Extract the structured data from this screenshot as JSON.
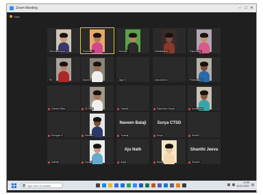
{
  "window": {
    "title": "Zoom Meeting",
    "controls": [
      "–",
      "□",
      "✕"
    ]
  },
  "meeting_bar": {
    "label": "View"
  },
  "participants": [
    {
      "name": "Sarvesh Kumar",
      "row": 0,
      "col": 0,
      "type": "video",
      "skin": "#c99a7a",
      "shirt": "#3a3a6a",
      "bg": "#cfc6b8"
    },
    {
      "name": "Sharmila...",
      "row": 0,
      "col": 1,
      "type": "video",
      "skin": "#b57a60",
      "shirt": "#d04a8a",
      "bg": "#e7a86a",
      "active": true
    },
    {
      "name": "Krishna...",
      "row": 0,
      "col": 2,
      "type": "video",
      "skin": "#b38364",
      "shirt": "#2a2a2a",
      "bg": "#5aa24a"
    },
    {
      "name": "Mahalakshmi",
      "row": 0,
      "col": 3,
      "type": "video",
      "skin": "#7a4a3a",
      "shirt": "#8a3a2a",
      "bg": "#3a2a2a"
    },
    {
      "name": "Rajeshwari",
      "row": 0,
      "col": 4,
      "type": "video",
      "skin": "#c48f74",
      "shirt": "#d85a8a",
      "bg": "#b0a8b4"
    },
    {
      "name": "RK",
      "row": 1,
      "col": 0,
      "type": "video",
      "skin": "#b88468",
      "shirt": "#aa2a2a",
      "bg": "#a8a29a"
    },
    {
      "name": "Naveen",
      "row": 1,
      "col": 1,
      "type": "video",
      "skin": "#9a6a50",
      "shirt": "#eeeeee",
      "bg": "#8a8478"
    },
    {
      "name": "Jaya S",
      "row": 1,
      "col": 2,
      "type": "blank"
    },
    {
      "name": "www.tamil.in",
      "row": 1,
      "col": 3,
      "type": "blank"
    },
    {
      "name": "Prabhakaran",
      "row": 1,
      "col": 4,
      "type": "video",
      "skin": "#7a4e38",
      "shirt": "#2a6aaa",
      "bg": "#b6b2aa"
    },
    {
      "name": "Ganesh Babu",
      "row": 2,
      "col": 0,
      "type": "blank",
      "mic": true
    },
    {
      "name": "Sri Ram",
      "row": 2,
      "col": 1,
      "type": "video",
      "skin": "#a87458",
      "shirt": "#f0f0f0",
      "bg": "#a09888",
      "mic": true
    },
    {
      "name": "Vasanth",
      "row": 2,
      "col": 2,
      "type": "blank",
      "mic": true
    },
    {
      "name": "Rajendran Gupta",
      "row": 2,
      "col": 3,
      "type": "blank",
      "mic": true
    },
    {
      "name": "Kumaravel",
      "row": 2,
      "col": 4,
      "type": "video",
      "skin": "#8a5a40",
      "shirt": "#3aa4a8",
      "bg": "#c9c2b6",
      "mic": true
    },
    {
      "name": "Murugan S",
      "row": 3,
      "col": 0,
      "type": "blank",
      "mic": true
    },
    {
      "name": "Ramesh",
      "row": 3,
      "col": 1,
      "type": "video",
      "skin": "#7a5038",
      "shirt": "#2a3a6a",
      "bg": "#e6e6e6",
      "mic": true
    },
    {
      "name": "Yuvaraj",
      "row": 3,
      "col": 2,
      "type": "name",
      "big": "Naveen Balaji",
      "mic": true
    },
    {
      "name": "Surya",
      "row": 3,
      "col": 3,
      "type": "name",
      "big": "Surya CTSD",
      "mic": true
    },
    {
      "name": "Senthil",
      "row": 3,
      "col": 4,
      "type": "blank",
      "mic": true
    },
    {
      "name": "Sathish",
      "row": 4,
      "col": 0,
      "type": "blank",
      "mic": true
    },
    {
      "name": "Kaviya",
      "row": 4,
      "col": 1,
      "type": "video",
      "skin": "#c89a80",
      "shirt": "#66aacc",
      "bg": "#eaf0f0",
      "mic": true
    },
    {
      "name": "Anjali",
      "row": 4,
      "col": 2,
      "type": "name",
      "big": "Aju Nath",
      "mic": true
    },
    {
      "name": "Baby",
      "row": 4,
      "col": 3,
      "type": "video",
      "skin": "#e8c69a",
      "shirt": "#f2d8b0",
      "bg": "#f4e6c8",
      "mic": true
    },
    {
      "name": "Shanthi",
      "row": 4,
      "col": 4,
      "type": "name",
      "big": "Shanthi Jeeva",
      "mic": true
    }
  ],
  "taskbar": {
    "search_placeholder": "Type here to search",
    "icons": [
      {
        "name": "task-view-icon",
        "color": "#444"
      },
      {
        "name": "edge-icon",
        "color": "#1a8fd6"
      },
      {
        "name": "explorer-icon",
        "color": "#e8b830"
      },
      {
        "name": "store-icon",
        "color": "#3a6ad6"
      },
      {
        "name": "mail-icon",
        "color": "#1a73d9"
      },
      {
        "name": "chrome-icon",
        "color": "#2aa84a"
      },
      {
        "name": "zoom-icon",
        "color": "#2d8cff"
      },
      {
        "name": "word-icon",
        "color": "#2a5aa8"
      },
      {
        "name": "excel-icon",
        "color": "#1f7a44"
      },
      {
        "name": "powerpoint-icon",
        "color": "#c8502a"
      },
      {
        "name": "teams-icon",
        "color": "#5a5ab0"
      },
      {
        "name": "photos-icon",
        "color": "#1a7ad0"
      },
      {
        "name": "settings-icon",
        "color": "#666"
      },
      {
        "name": "vlc-icon",
        "color": "#e8801a"
      },
      {
        "name": "app-icon",
        "color": "#3a3a3a"
      }
    ],
    "time": "11:35",
    "date": "04-12-2021"
  }
}
